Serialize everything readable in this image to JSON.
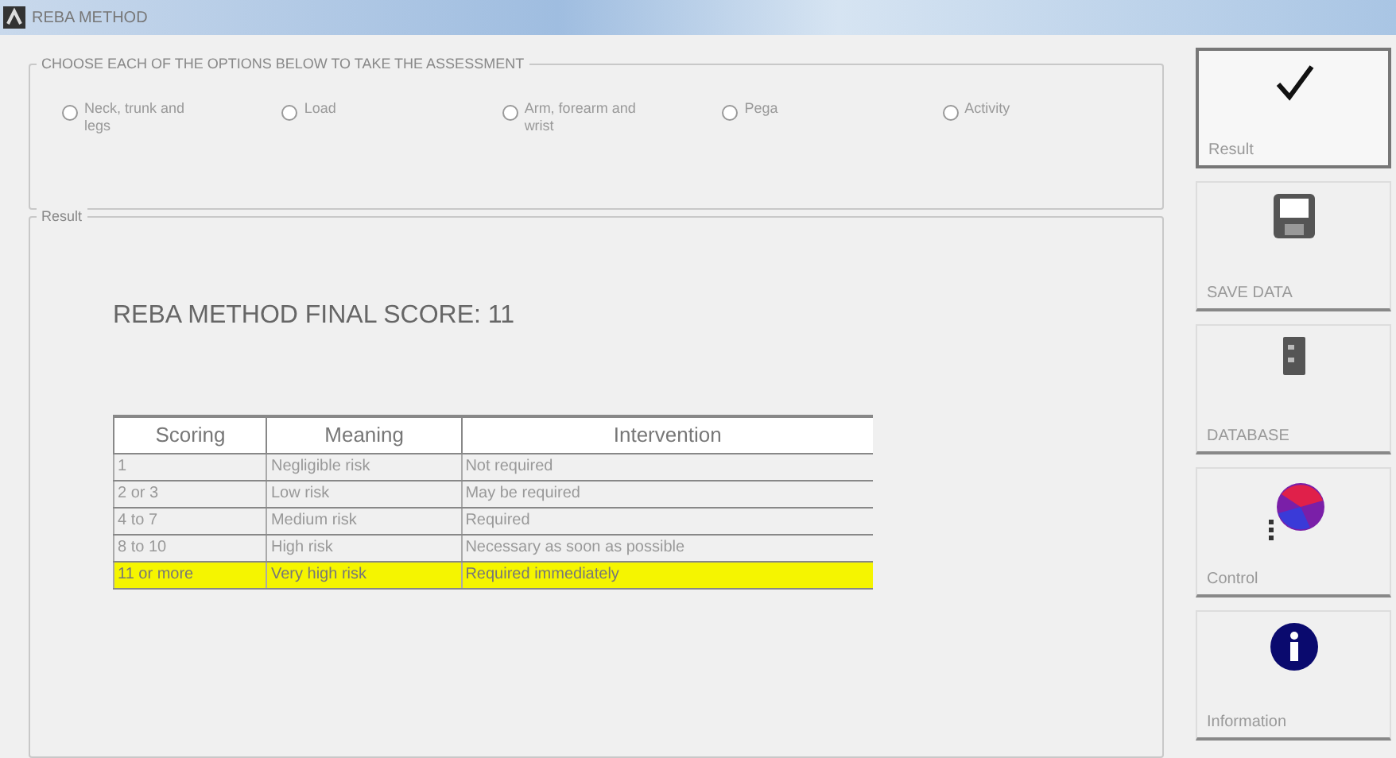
{
  "window": {
    "title": "REBA METHOD"
  },
  "options_group": {
    "title": "CHOOSE EACH OF THE OPTIONS BELOW TO TAKE THE ASSESSMENT",
    "options": [
      {
        "label": "Neck, trunk and legs",
        "selected": false
      },
      {
        "label": "Load",
        "selected": false
      },
      {
        "label": "Arm, forearm and wrist",
        "selected": false
      },
      {
        "label": "Pega",
        "selected": false
      },
      {
        "label": "Activity",
        "selected": false
      }
    ]
  },
  "result_group": {
    "title": "Result",
    "final_score": "REBA METHOD FINAL SCORE: 11",
    "table": {
      "columns": [
        "Scoring",
        "Meaning",
        "Intervention"
      ],
      "rows": [
        {
          "cells": [
            "1",
            "Negligible risk",
            "Not required"
          ],
          "selected": false
        },
        {
          "cells": [
            "2 or 3",
            "Low risk",
            "May be required"
          ],
          "selected": false
        },
        {
          "cells": [
            "4 to 7",
            "Medium risk",
            "Required"
          ],
          "selected": false
        },
        {
          "cells": [
            "8 to 10",
            "High risk",
            "Necessary as soon as possible"
          ],
          "selected": false
        },
        {
          "cells": [
            "11 or more",
            "Very high risk",
            "Required immediately"
          ],
          "selected": true
        }
      ]
    }
  },
  "side_buttons": [
    {
      "kind": "check",
      "label": "Result",
      "selected": true
    },
    {
      "kind": "save",
      "label": "SAVE DATA",
      "selected": false
    },
    {
      "kind": "database",
      "label": "DATABASE",
      "selected": false
    },
    {
      "kind": "control",
      "label": "Control",
      "selected": false
    },
    {
      "kind": "info",
      "label": "Information",
      "selected": false
    }
  ]
}
